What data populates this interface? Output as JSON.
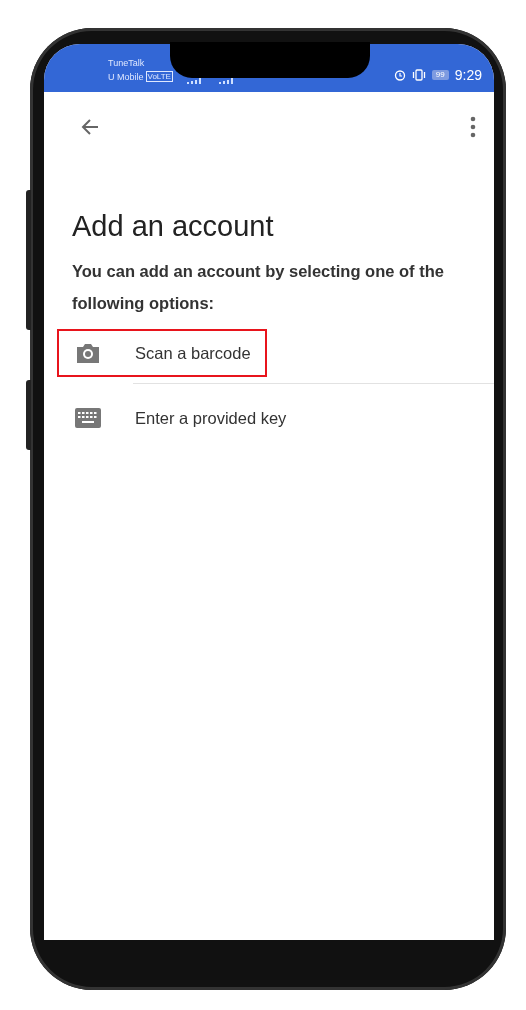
{
  "status_bar": {
    "carrier_1": "TuneTalk",
    "carrier_2": "U Mobile",
    "network_badge": "VoLTE",
    "battery": "99",
    "time": "9:29"
  },
  "title": "Add an account",
  "description": "You can add an account by selecting one of the following options:",
  "options": [
    {
      "kind": "camera",
      "label": "Scan a barcode",
      "highlighted": true
    },
    {
      "kind": "keyboard",
      "label": "Enter a provided key",
      "highlighted": false
    }
  ]
}
